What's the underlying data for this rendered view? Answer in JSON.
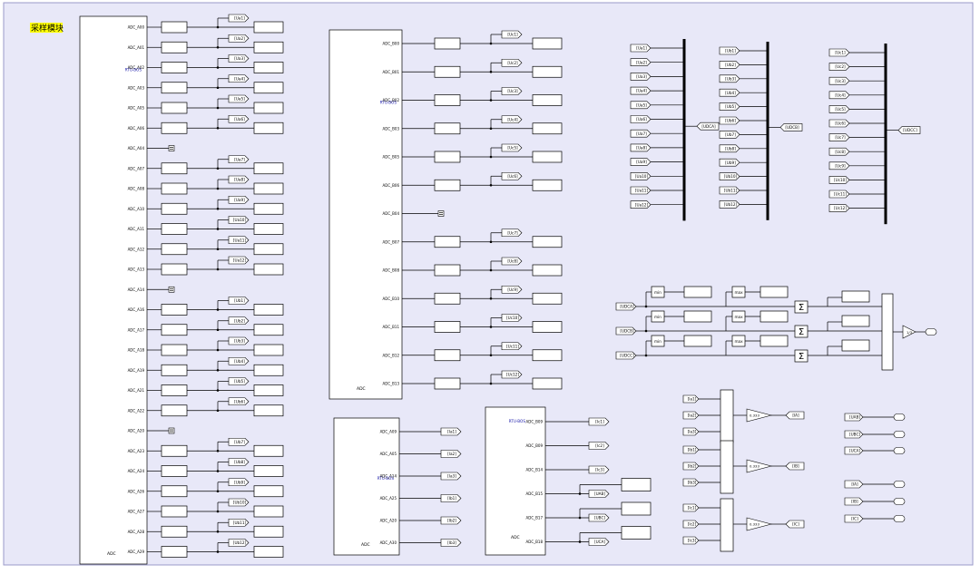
{
  "title": "采样模块",
  "colors": {
    "background": "#e8e8f8",
    "title_bg": "#ffff00",
    "line": "#000000",
    "port": "#1a1aaa"
  },
  "block_a": {
    "model_label": "ADC",
    "sublabel": "RTU-BOS",
    "ports": [
      "ADC_A00",
      "ADC_A01",
      "ADC_A02",
      "ADC_A03",
      "ADC_A05",
      "ADC_A06",
      "ADC_A04",
      "ADC_A07",
      "ADC_A08",
      "ADC_A10",
      "ADC_A11",
      "ADC_A12",
      "ADC_A13",
      "ADC_A14",
      "ADC_A16",
      "ADC_A17",
      "ADC_A18",
      "ADC_A19",
      "ADC_A21",
      "ADC_A22",
      "ADC_A20",
      "ADC_A23",
      "ADC_A24",
      "ADC_A26",
      "ADC_A27",
      "ADC_A28",
      "ADC_A29"
    ],
    "gotos": [
      "[Ua1]",
      "[Ua2]",
      "[Ua3]",
      "[Ua4]",
      "[Ua5]",
      "[Ua6]",
      "",
      "[Ua7]",
      "[Ua8]",
      "[Ua9]",
      "[Ua10]",
      "[Ua11]",
      "[Ua12]",
      "",
      "[Ub1]",
      "[Ub2]",
      "[Ub3]",
      "[Ub4]",
      "[Ub5]",
      "[Ub6]",
      "",
      "[Ub7]",
      "[Ub8]",
      "[Ub9]",
      "[Ub10]",
      "[Ub11]",
      "[Ub12]"
    ]
  },
  "block_b": {
    "model_label": "ADC",
    "sublabel": "RTU-BOS",
    "ports": [
      "ADC_B00",
      "ADC_B01",
      "ADC_B02",
      "ADC_B03",
      "ADC_B05",
      "ADC_B06",
      "ADC_B04",
      "ADC_B07",
      "ADC_B08",
      "ADC_B10",
      "ADC_B11",
      "ADC_B12",
      "ADC_B13"
    ],
    "gotos": [
      "[Uc1]",
      "[Uc2]",
      "[Uc3]",
      "[Uc4]",
      "[Uc5]",
      "[Uc6]",
      "",
      "[Uc7]",
      "[Uc8]",
      "[Uc9]",
      "[Uc10]",
      "[Uc11]",
      "[Uc12]"
    ]
  },
  "block_c": {
    "model_label": "ADC",
    "sublabel": "RTU-BOS",
    "ports": [
      "ADC_A09",
      "ADC_A05",
      "ADC_A14",
      "ADC_A25",
      "ADC_A20",
      "ADC_A30"
    ],
    "gotos": [
      "[Ia1]",
      "[Ia2]",
      "[Ia3]",
      "[Ib1]",
      "[Ib2]",
      "[Ib3]"
    ]
  },
  "block_d": {
    "model_label": "ADC",
    "sublabel": "RTU-BOS",
    "ports": [
      "ADC_B09",
      "ADC_B09",
      "ADC_B14",
      "ADC_B15",
      "ADC_B17",
      "ADC_B18"
    ],
    "gotos": [
      "[Ic1]",
      "[Ic2]",
      "[Ic3]",
      "[UAB]",
      "[UBC]",
      "[UCA]"
    ]
  },
  "mux": [
    {
      "inputs": [
        "[Ua1]",
        "[Ua2]",
        "[Ua3]",
        "[Ua4]",
        "[Ua5]",
        "[Ua6]",
        "[Ua7]",
        "[Ua8]",
        "[Ua9]",
        "[Ua10]",
        "[Ua11]",
        "[Ua12]"
      ],
      "output": "[UDCA]"
    },
    {
      "inputs": [
        "[Ub1]",
        "[Ub2]",
        "[Ub3]",
        "[Ub4]",
        "[Ub5]",
        "[Ub6]",
        "[Ub7]",
        "[Ub8]",
        "[Ub9]",
        "[Ub10]",
        "[Ub11]",
        "[Ub12]"
      ],
      "output": "[UDCB]"
    },
    {
      "inputs": [
        "[Uc1]",
        "[Uc2]",
        "[Uc3]",
        "[Uc4]",
        "[Uc5]",
        "[Uc6]",
        "[Uc7]",
        "[Uc8]",
        "[Uc9]",
        "[Uc10]",
        "[Uc11]",
        "[Uc12]"
      ],
      "output": "[UDCC]"
    }
  ],
  "minmax": {
    "froms": [
      "[UDCA]",
      "[UDCB]",
      "[UDCC]"
    ],
    "min_label": "min",
    "max_label": "max",
    "sum_symbol": "Σ",
    "mux_gain": "1/3"
  },
  "currents": [
    {
      "inputs": [
        "[Ia1]",
        "[Ia2]",
        "[Ia3]"
      ],
      "gain": "0.333",
      "output": "[IA]"
    },
    {
      "inputs": [
        "[Ib1]",
        "[Ib2]",
        "[Ib3]"
      ],
      "gain": "0.333",
      "output": "[IB]"
    },
    {
      "inputs": [
        "[Ic1]",
        "[Ic2]",
        "[Ic3]"
      ],
      "gain": "0.333",
      "output": "[IC]"
    }
  ],
  "terminators": [
    "[UAB]",
    "[UBC]",
    "[UCA]",
    "[IA]",
    "[IB]",
    "[IC]"
  ]
}
